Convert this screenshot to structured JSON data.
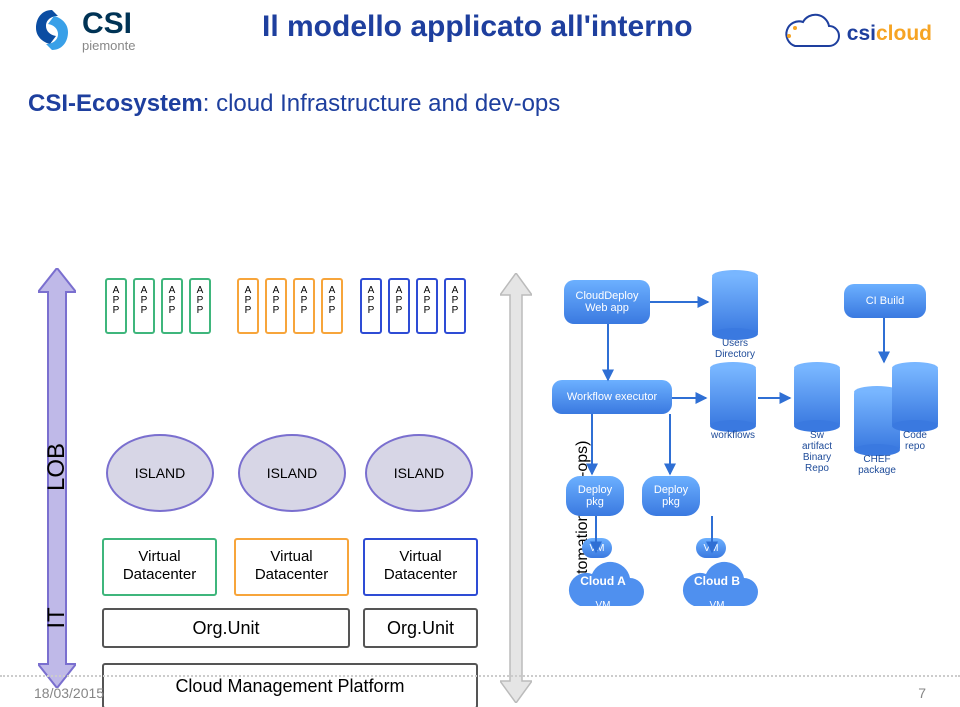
{
  "header": {
    "logo_main": "CSI",
    "logo_sub": "piemonte",
    "title": "Il modello applicato all'interno",
    "cloud_brand_a": "csi",
    "cloud_brand_b": "cloud"
  },
  "subtitle": {
    "bold": "CSI-Ecosystem",
    "rest": ": cloud Infrastructure and dev-ops"
  },
  "axis": {
    "lob": "LOB",
    "it": "IT"
  },
  "app_label": {
    "line1": "A",
    "line2": "P",
    "line3": "P"
  },
  "islands": {
    "i1": "ISLAND",
    "i2": "ISLAND",
    "i3": "ISLAND"
  },
  "vdc": {
    "line1": "Virtual",
    "line2": "Datacenter"
  },
  "org": {
    "o1": "Org.Unit",
    "o2": "Org.Unit"
  },
  "cmp": "Cloud Management Platform",
  "automation": "Automation (dev-ops)",
  "right": {
    "cloud_deploy_l1": "CloudDeploy",
    "cloud_deploy_l2": "Web app",
    "users_dir": "Users Directory",
    "ci_build": "CI Build",
    "wf_exec": "Workflow executor",
    "workflows": "workflows",
    "sw_artifact": "Sw artifact Binary Repo",
    "chef_pkg": "CHEF package",
    "code_repo": "Code repo",
    "deploy_pkg": "Deploy pkg",
    "cloud_a": "Cloud A",
    "cloud_b": "Cloud B",
    "vm": "VM"
  },
  "footer": {
    "date": "18/03/2015",
    "page": "7"
  }
}
